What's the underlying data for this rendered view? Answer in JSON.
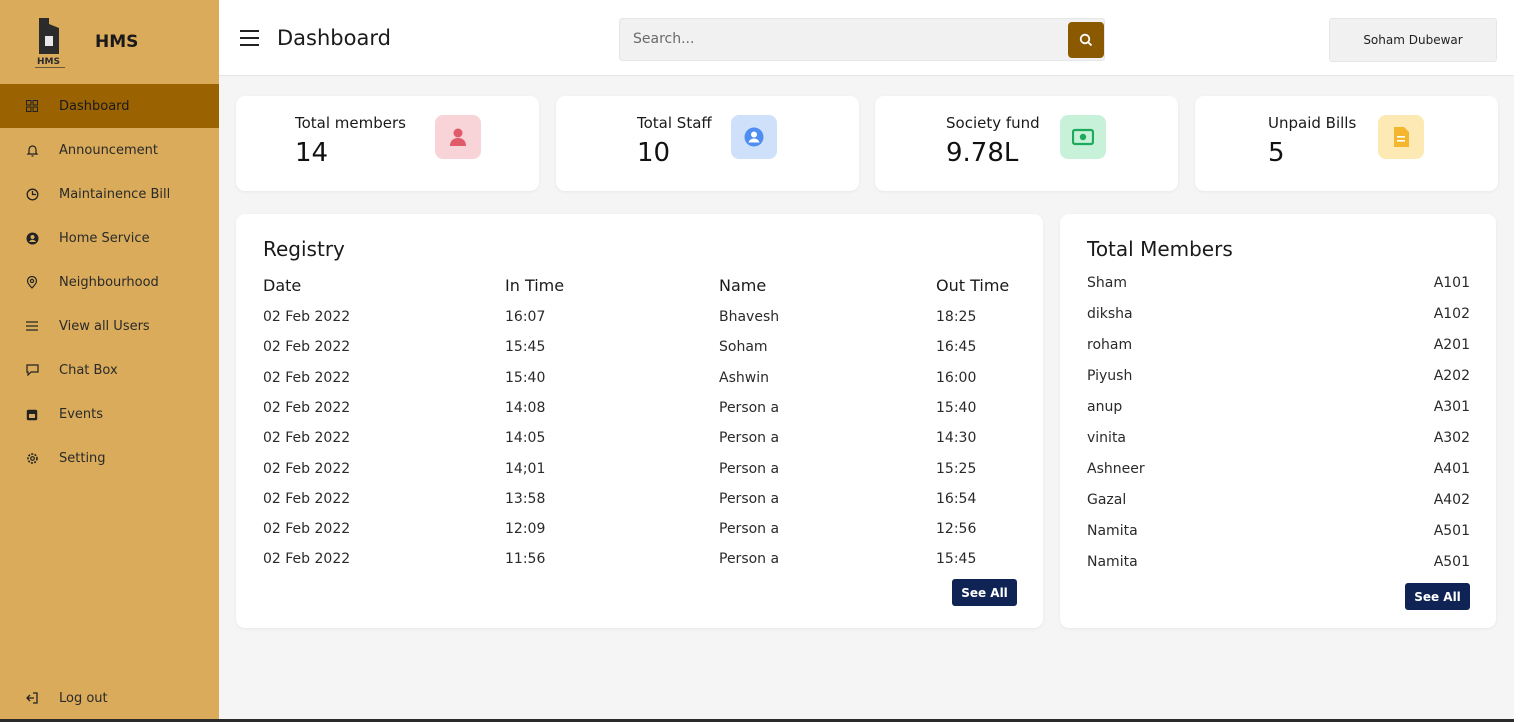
{
  "brand": {
    "name": "HMS",
    "logo_text": "HMS"
  },
  "sidebar": {
    "items": [
      {
        "label": "Dashboard",
        "icon": "grid-icon",
        "active": true
      },
      {
        "label": "Announcement",
        "icon": "bell-icon"
      },
      {
        "label": "Maintainence Bill",
        "icon": "clock-icon"
      },
      {
        "label": "Home Service",
        "icon": "user-circle-icon"
      },
      {
        "label": "Neighbourhood",
        "icon": "map-pin-icon"
      },
      {
        "label": "View all Users",
        "icon": "list-icon"
      },
      {
        "label": "Chat Box",
        "icon": "chat-icon"
      },
      {
        "label": "Events",
        "icon": "calendar-icon"
      },
      {
        "label": "Setting",
        "icon": "gear-icon"
      }
    ],
    "logout": {
      "label": "Log out",
      "icon": "logout-icon"
    }
  },
  "header": {
    "title": "Dashboard",
    "search_placeholder": "Search...",
    "user_name": "Soham Dubewar"
  },
  "stats": [
    {
      "label": "Total members",
      "value": "14",
      "icon": "person-icon",
      "icon_color": "#e05b6a",
      "icon_bg": "#f8d3d7"
    },
    {
      "label": "Total Staff",
      "value": "10",
      "icon": "user-circle-icon",
      "icon_color": "#4e8ef0",
      "icon_bg": "#cfe0fb"
    },
    {
      "label": "Society fund",
      "value": "9.78L",
      "icon": "money-icon",
      "icon_color": "#1eaa5c",
      "icon_bg": "#c8f1d9"
    },
    {
      "label": "Unpaid Bills",
      "value": "5",
      "icon": "document-icon",
      "icon_color": "#f4b62c",
      "icon_bg": "#fde9b4"
    }
  ],
  "registry": {
    "title": "Registry",
    "columns": [
      "Date",
      "In Time",
      "Name",
      "Out Time"
    ],
    "rows": [
      [
        "02 Feb 2022",
        "16:07",
        "Bhavesh",
        "18:25"
      ],
      [
        "02 Feb 2022",
        "15:45",
        "Soham",
        "16:45"
      ],
      [
        "02 Feb 2022",
        "15:40",
        "Ashwin",
        "16:00"
      ],
      [
        "02 Feb 2022",
        "14:08",
        "Person a",
        "15:40"
      ],
      [
        "02 Feb 2022",
        "14:05",
        "Person a",
        "14:30"
      ],
      [
        "02 Feb 2022",
        "14;01",
        "Person a",
        "15:25"
      ],
      [
        "02 Feb 2022",
        "13:58",
        "Person a",
        "16:54"
      ],
      [
        "02 Feb 2022",
        "12:09",
        "Person a",
        "12:56"
      ],
      [
        "02 Feb 2022",
        "11:56",
        "Person a",
        "15:45"
      ]
    ],
    "see_all": "See All"
  },
  "members": {
    "title": "Total Members",
    "rows": [
      [
        "Sham",
        "A101"
      ],
      [
        "diksha",
        "A102"
      ],
      [
        "roham",
        "A201"
      ],
      [
        "Piyush",
        "A202"
      ],
      [
        "anup",
        "A301"
      ],
      [
        "vinita",
        "A302"
      ],
      [
        "Ashneer",
        "A401"
      ],
      [
        "Gazal",
        "A402"
      ],
      [
        "Namita",
        "A501"
      ],
      [
        "Namita",
        "A501"
      ]
    ],
    "see_all": "See All"
  },
  "colors": {
    "sidebar_bg": "#d9ab5a",
    "sidebar_active": "#9a6200",
    "search_button": "#8b5a00",
    "see_all_button": "#0f2454"
  }
}
